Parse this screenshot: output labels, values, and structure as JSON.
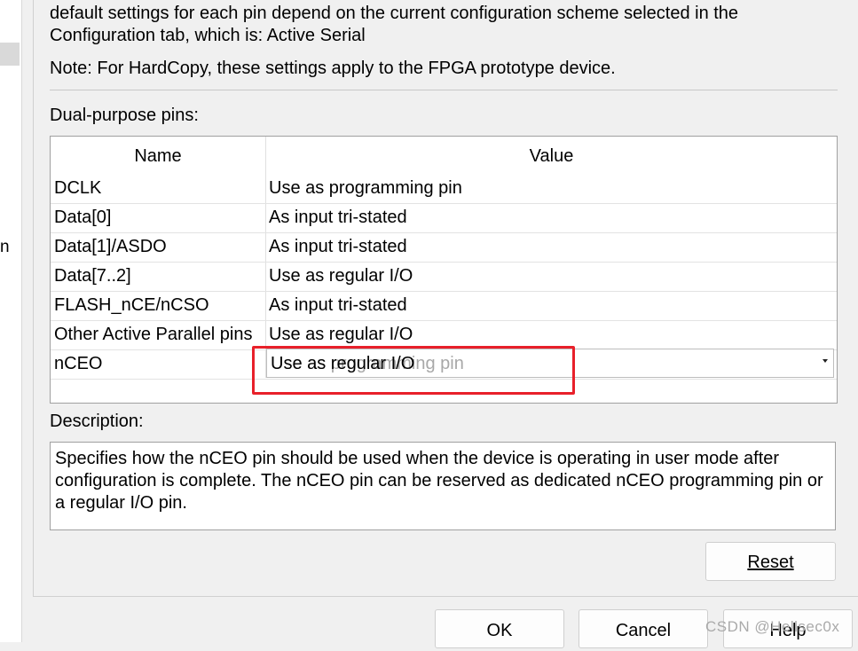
{
  "intro_text": "default settings for each pin depend on the current configuration scheme selected in the Configuration tab, which is:  Active Serial",
  "note_text": "Note: For HardCopy, these settings apply to the FPGA prototype device.",
  "left_glyph": "n",
  "dual_purpose": {
    "label": "Dual-purpose pins:",
    "columns": {
      "name": "Name",
      "value": "Value"
    },
    "rows": [
      {
        "name": "DCLK",
        "value": "Use as programming pin"
      },
      {
        "name": "Data[0]",
        "value": "As input tri-stated"
      },
      {
        "name": "Data[1]/ASDO",
        "value": "As input tri-stated"
      },
      {
        "name": "Data[7..2]",
        "value": "Use as regular I/O"
      },
      {
        "name": "FLASH_nCE/nCSO",
        "value": "As input tri-stated"
      },
      {
        "name": "Other Active Parallel pins",
        "value": "Use as regular I/O"
      }
    ],
    "edit_row": {
      "name": "nCEO",
      "previous_value": "Use as programming pin",
      "selected_value": "Use as regular I/O"
    }
  },
  "description": {
    "label": "Description:",
    "text": "Specifies how the nCEO pin should be used when the device is operating in user mode after configuration is complete. The nCEO pin can be reserved as dedicated nCEO programming pin or a regular I/O pin."
  },
  "buttons": {
    "reset": "Reset",
    "ok": "OK",
    "cancel": "Cancel",
    "help": "Help"
  },
  "watermark": "CSDN @Hellsec0x",
  "colors": {
    "highlight": "#e8202a",
    "background": "#f0f0f0"
  }
}
